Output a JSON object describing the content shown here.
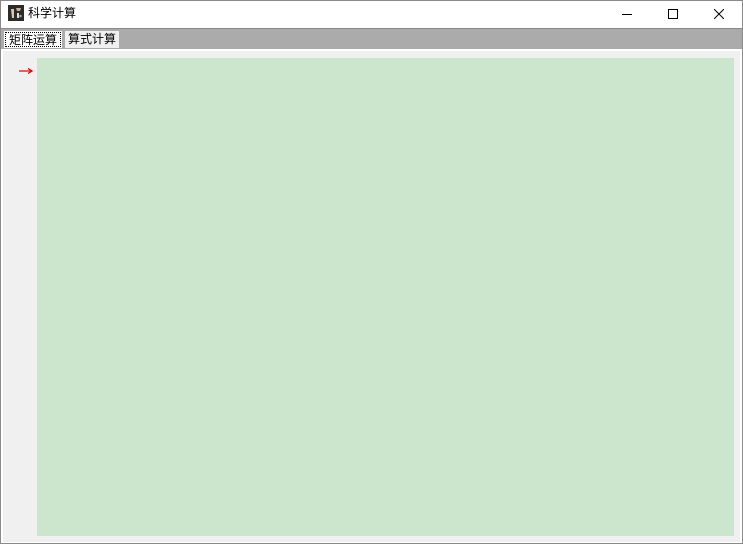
{
  "window": {
    "title": "科学计算",
    "app_icon": "calculator-app-icon",
    "controls": {
      "minimize_icon": "minimize-icon",
      "maximize_icon": "maximize-icon",
      "close_icon": "close-icon"
    }
  },
  "tabs": [
    {
      "label": "矩阵运算",
      "active": true
    },
    {
      "label": "算式计算",
      "active": false
    }
  ],
  "editor": {
    "marker_icon": "arrow-right-icon",
    "marker_color": "#e00000",
    "background_color": "#cce6cd",
    "content": ""
  },
  "colors": {
    "tabstrip_background": "#ababab",
    "panel_background": "#f0f0f0"
  }
}
